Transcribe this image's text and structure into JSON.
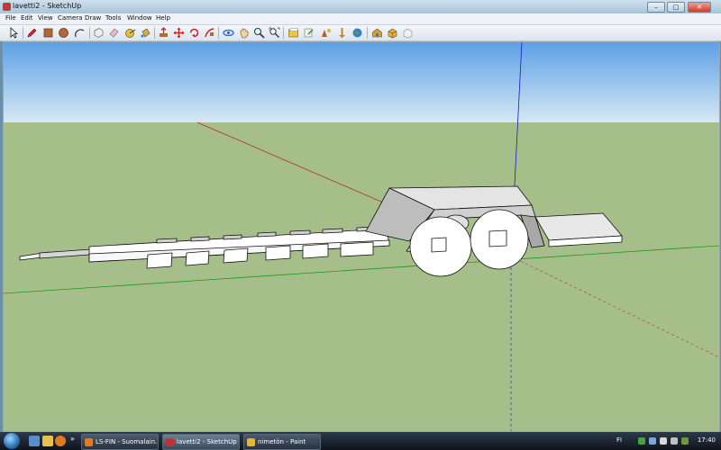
{
  "window": {
    "title": "lavetti2 - SketchUp"
  },
  "menu": [
    "File",
    "Edit",
    "View",
    "Camera",
    "Draw",
    "Tools",
    "Window",
    "Help"
  ],
  "toolbar": {
    "tools": [
      {
        "name": "select-tool",
        "icon": "arrow-icon"
      },
      {
        "name": "line-tool",
        "icon": "pencil-icon"
      },
      {
        "name": "rectangle-tool",
        "icon": "rectangle-icon"
      },
      {
        "name": "circle-tool",
        "icon": "circle-icon"
      },
      {
        "name": "arc-tool",
        "icon": "arc-icon"
      },
      {
        "name": "make-component-tool",
        "icon": "component-icon"
      },
      {
        "name": "eraser-tool",
        "icon": "eraser-icon"
      },
      {
        "name": "tape-measure-tool",
        "icon": "tape-icon"
      },
      {
        "name": "paint-bucket-tool",
        "icon": "bucket-icon"
      },
      {
        "name": "push-pull-tool",
        "icon": "push-pull-icon"
      },
      {
        "name": "move-tool",
        "icon": "move-icon"
      },
      {
        "name": "rotate-tool",
        "icon": "rotate-icon"
      },
      {
        "name": "follow-me-tool",
        "icon": "follow-me-icon"
      },
      {
        "name": "orbit-tool",
        "icon": "orbit-icon"
      },
      {
        "name": "pan-tool",
        "icon": "hand-icon"
      },
      {
        "name": "zoom-tool",
        "icon": "magnifier-icon"
      },
      {
        "name": "zoom-extents-tool",
        "icon": "zoom-extents-icon"
      },
      {
        "name": "get-models-tool",
        "icon": "folder-icon"
      },
      {
        "name": "share-model-tool",
        "icon": "share-icon"
      },
      {
        "name": "get-photo-texture-tool",
        "icon": "photo-icon"
      },
      {
        "name": "place-model-tool",
        "icon": "place-icon"
      },
      {
        "name": "google-earth-tool",
        "icon": "globe-icon"
      },
      {
        "name": "3d-warehouse-tool",
        "icon": "warehouse-icon"
      },
      {
        "name": "share-component-tool",
        "icon": "component-share-icon"
      },
      {
        "name": "extension-tool",
        "icon": "extension-icon"
      }
    ]
  },
  "taskbar": {
    "tasks": [
      {
        "label": "LS-FIN - Suomalain...",
        "icon_color": "#e07b22"
      },
      {
        "label": "lavetti2 - SketchUp",
        "icon_color": "#c8302c"
      },
      {
        "label": "nimetön - Paint",
        "icon_color": "#e3b63a"
      }
    ],
    "quicklaunch_more": "»",
    "language": "FI",
    "clock": "17:40"
  },
  "colors": {
    "sky_top": "#5da0e6",
    "sky_bottom": "#d6e8f4",
    "ground": "#a6bf8a",
    "axis_red": "#b03030",
    "axis_green": "#1a9a1a",
    "axis_blue": "#1a1ac8"
  }
}
